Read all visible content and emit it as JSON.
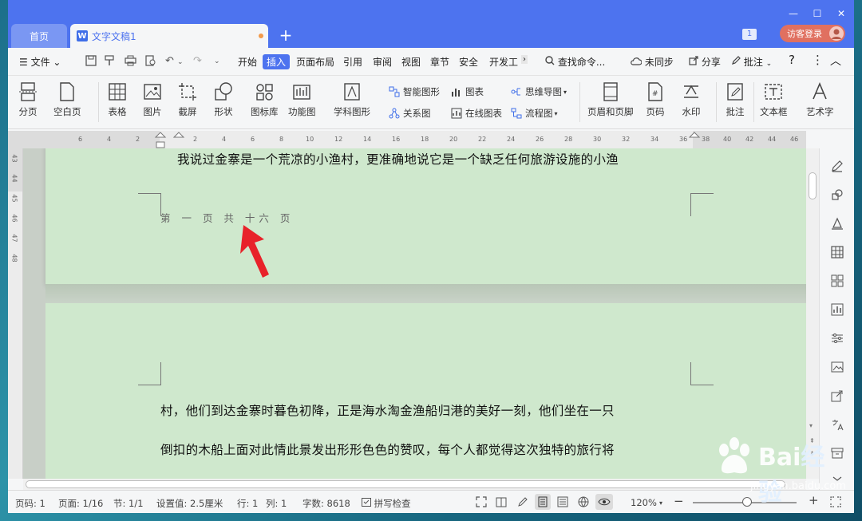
{
  "titlebar": {
    "tabs": [
      {
        "label": "首页"
      },
      {
        "label": "文字文稿1",
        "icon": "W"
      }
    ],
    "new_tab": "+",
    "window_count": "1",
    "login_label": "访客登录"
  },
  "menubar": {
    "file_label": "文件",
    "items": [
      "开始",
      "插入",
      "页面布局",
      "引用",
      "审阅",
      "视图",
      "章节",
      "安全",
      "开发工"
    ],
    "active": "插入",
    "search_label": "查找命令...",
    "sync_label": "未同步",
    "share_label": "分享",
    "comment_label": "批注"
  },
  "ribbon": {
    "page_break": "分页",
    "blank_page": "空白页",
    "table": "表格",
    "picture": "图片",
    "screenshot": "截屏",
    "shape": "形状",
    "icon_lib": "图标库",
    "function_chart": "功能图",
    "science_shape": "学科图形",
    "smart_shape": "智能图形",
    "chart": "图表",
    "mindmap": "思维导图",
    "relation": "关系图",
    "online_chart": "在线图表",
    "flowchart": "流程图",
    "header_footer": "页眉和页脚",
    "page_number": "页码",
    "watermark": "水印",
    "comment": "批注",
    "textbox": "文本框",
    "wordart": "艺术字"
  },
  "ruler": {
    "h_ticks": [
      "6",
      "4",
      "2",
      "2",
      "4",
      "6",
      "8",
      "10",
      "12",
      "14",
      "16",
      "18",
      "20",
      "22",
      "24",
      "26",
      "28",
      "30",
      "32",
      "34",
      "36",
      "38",
      "40",
      "42",
      "44",
      "46"
    ],
    "v_ticks": [
      "43",
      "44",
      "45",
      "46",
      "47",
      "48"
    ]
  },
  "document": {
    "page1_line": "我说过金寨是一个荒凉的小渔村，更准确地说它是一个缺乏任何旅游设施的小渔",
    "footer": "第 一 页 共 十六 页",
    "page2_line1": "村，他们到达金寨时暮色初降，正是海水淘金渔船归港的美好一刻，他们坐在一只",
    "page2_line2": "倒扣的木船上面对此情此景发出形形色色的赞叹，每个人都觉得这次独特的旅行将"
  },
  "status": {
    "page_code": "页码: 1",
    "page": "页面: 1/16",
    "section": "节: 1/1",
    "setting": "设置值: 2.5厘米",
    "row": "行: 1",
    "col": "列: 1",
    "words": "字数: 8618",
    "spell": "拼写检查",
    "zoom": "120%",
    "zoom_minus": "−",
    "zoom_plus": "+"
  },
  "watermark": {
    "brand": "Bai",
    "brand2": "经验",
    "url": "jingyan.baidu.com"
  },
  "colors": {
    "accent": "#4d73ef",
    "page_bg": "#cfe8cd",
    "arrow": "#e8222a"
  }
}
